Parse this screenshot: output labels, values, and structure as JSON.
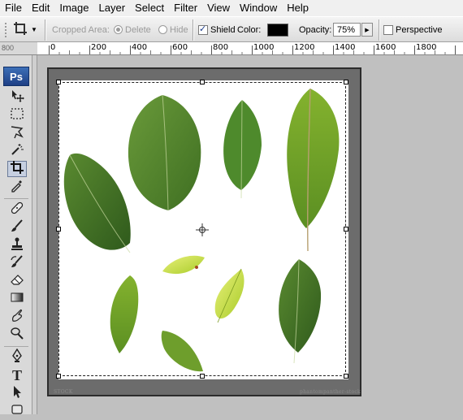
{
  "menu": [
    "File",
    "Edit",
    "Image",
    "Layer",
    "Select",
    "Filter",
    "View",
    "Window",
    "Help"
  ],
  "options": {
    "cropped_area_label": "Cropped Area:",
    "delete_label": "Delete",
    "hide_label": "Hide",
    "shield_label": "Shield",
    "shield_checked": true,
    "color_label": "Color:",
    "shield_color": "#000000",
    "opacity_label": "Opacity:",
    "opacity_value": "75%",
    "perspective_label": "Perspective",
    "perspective_checked": false
  },
  "ruler": {
    "corner_label": "800",
    "labels": [
      "0",
      "200",
      "400",
      "600",
      "800",
      "1000",
      "1200",
      "1400",
      "1600",
      "1800"
    ]
  },
  "toolbox": {
    "logo": "Ps",
    "tools": [
      "move",
      "marquee",
      "lasso",
      "magic-wand",
      "crop",
      "eyedropper",
      "healing-brush",
      "brush",
      "clone-stamp",
      "history-brush",
      "eraser",
      "gradient",
      "blur",
      "dodge",
      "pen",
      "type",
      "path-selection",
      "shape"
    ],
    "active_tool": "crop"
  },
  "document": {
    "watermark_left": "STOCK",
    "watermark_right": "phantompanther-stock"
  },
  "colors": {
    "accent": "#1e3f85",
    "leaf_dark": "#3f7a2a",
    "leaf_light": "#b9d83a"
  }
}
